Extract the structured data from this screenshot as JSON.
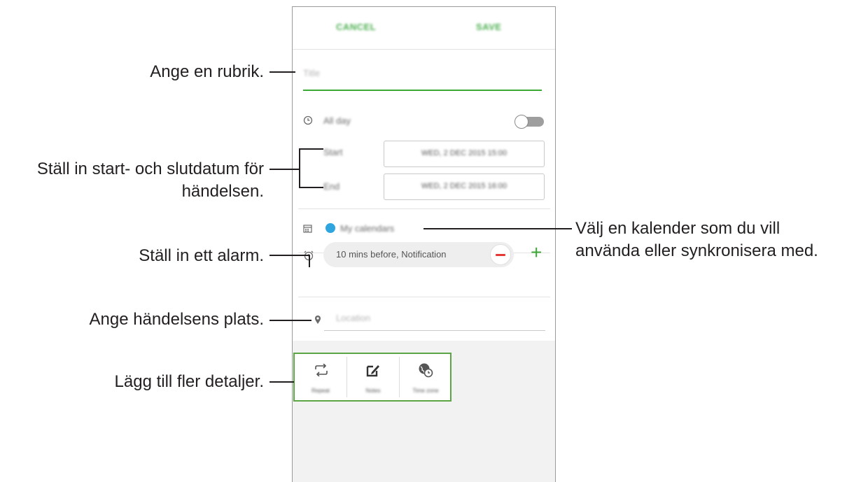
{
  "annotations": {
    "title": "Ange en rubrik.",
    "dates_line1": "Ställ in start- och slutdatum för",
    "dates_line2": "händelsen.",
    "alarm": "Ställ in ett alarm.",
    "location": "Ange händelsens plats.",
    "details": "Lägg till fler detaljer.",
    "calendar_line1": "Välj en kalender som du vill",
    "calendar_line2": "använda eller synkronisera med."
  },
  "toolbar": {
    "cancel_label": "CANCEL",
    "save_label": "SAVE"
  },
  "form": {
    "title_placeholder": "Title",
    "all_day_label": "All day",
    "all_day_on": false,
    "start_label": "Start",
    "start_value": "WED, 2 DEC 2015  15:00",
    "end_label": "End",
    "end_value": "WED, 2 DEC 2015  16:00",
    "calendar_name": "My calendars",
    "calendar_color": "#2fa5e0",
    "reminder_value": "10 mins before, Notification",
    "location_placeholder": "Location"
  },
  "details": {
    "items": [
      {
        "label": "Repeat",
        "icon": "repeat-icon"
      },
      {
        "label": "Notes",
        "icon": "notes-icon"
      },
      {
        "label": "Time zone",
        "icon": "time-zone-icon"
      }
    ]
  },
  "colors": {
    "accent": "#3aaa35",
    "remove": "#e53935",
    "calendar_dot": "#2fa5e0"
  }
}
